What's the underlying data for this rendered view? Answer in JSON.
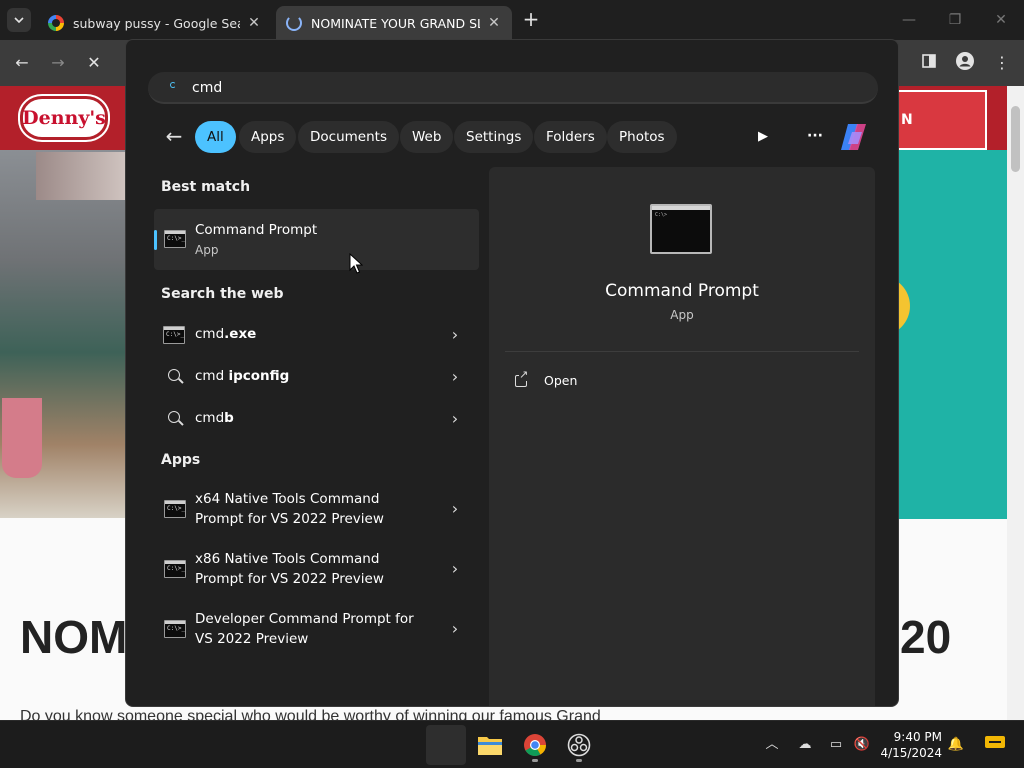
{
  "browser": {
    "tabs": [
      {
        "title": "subway pussy - Google Search",
        "icon": "google-favicon"
      },
      {
        "title": "NOMINATE YOUR GRAND SLA",
        "icon": "loading-favicon"
      }
    ],
    "new_tab": "+",
    "close": "✕"
  },
  "page": {
    "logo": "Denny's",
    "cta_label": "N",
    "heading_left": "NOM",
    "heading_right": "20",
    "body_text": "Do you know someone special who would be worthy of winning our famous Grand"
  },
  "search": {
    "query": "cmd",
    "filters": [
      "All",
      "Apps",
      "Documents",
      "Web",
      "Settings",
      "Folders",
      "Photos"
    ],
    "active_filter": "All",
    "sections": {
      "best_match": "Best match",
      "search_web": "Search the web",
      "apps": "Apps"
    },
    "best_match": {
      "title": "Command Prompt",
      "subtitle": "App"
    },
    "web_results": [
      {
        "prefix": "cmd",
        "bold": ".exe",
        "icon": "cmd-icon"
      },
      {
        "prefix": "cmd ",
        "bold": "ipconfig",
        "icon": "search-icon"
      },
      {
        "prefix": "cmd",
        "bold": "b",
        "icon": "search-icon"
      }
    ],
    "apps": [
      {
        "line1": "x64 Native Tools Command",
        "line2": "Prompt for VS 2022 Preview"
      },
      {
        "line1": "x86 Native Tools Command",
        "line2": "Prompt for VS 2022 Preview"
      },
      {
        "line1": "Developer Command Prompt for",
        "line2": "VS 2022 Preview"
      }
    ],
    "detail": {
      "title": "Command Prompt",
      "type": "App",
      "actions": [
        {
          "label": "Open",
          "icon": "open-external-icon"
        }
      ]
    }
  },
  "taskbar": {
    "time": "9:40 PM",
    "date": "4/15/2024",
    "apps": [
      "start",
      "file-explorer",
      "chrome",
      "obs"
    ]
  },
  "colors": {
    "accent": "#4cc2ff",
    "panel": "#202020",
    "dennys_red": "#b3202a"
  }
}
